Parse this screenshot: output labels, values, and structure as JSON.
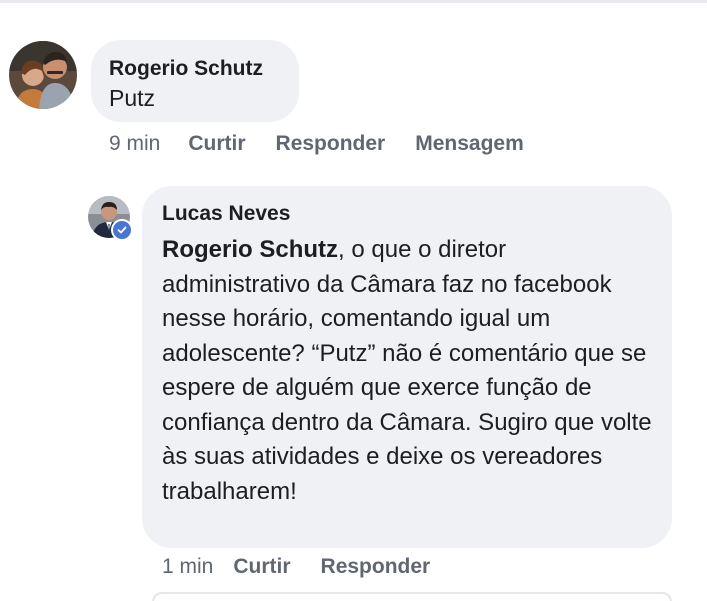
{
  "comment": {
    "author": "Rogerio Schutz",
    "text": "Putz",
    "time": "9 min",
    "actions": {
      "like": "Curtir",
      "reply": "Responder",
      "message": "Mensagem"
    }
  },
  "reply": {
    "author": "Lucas Neves",
    "verified": true,
    "mention": "Rogerio Schutz",
    "text": ", o que o diretor administrativo da Câmara faz no facebook nesse horário, comentando igual um adolescente? “Putz” não é comentário que se espere de alguém que exerce função de confiança dentro da Câmara. Sugiro que volte às suas atividades e deixe os vereadores trabalharem!",
    "time": "1 min",
    "actions": {
      "like": "Curtir",
      "reply": "Responder"
    }
  },
  "colors": {
    "bubble": "#f0f1f4",
    "action_text": "#606770",
    "verified_badge": "#4a76d2"
  },
  "icons": {
    "verified_badge": "verified-check-icon"
  }
}
